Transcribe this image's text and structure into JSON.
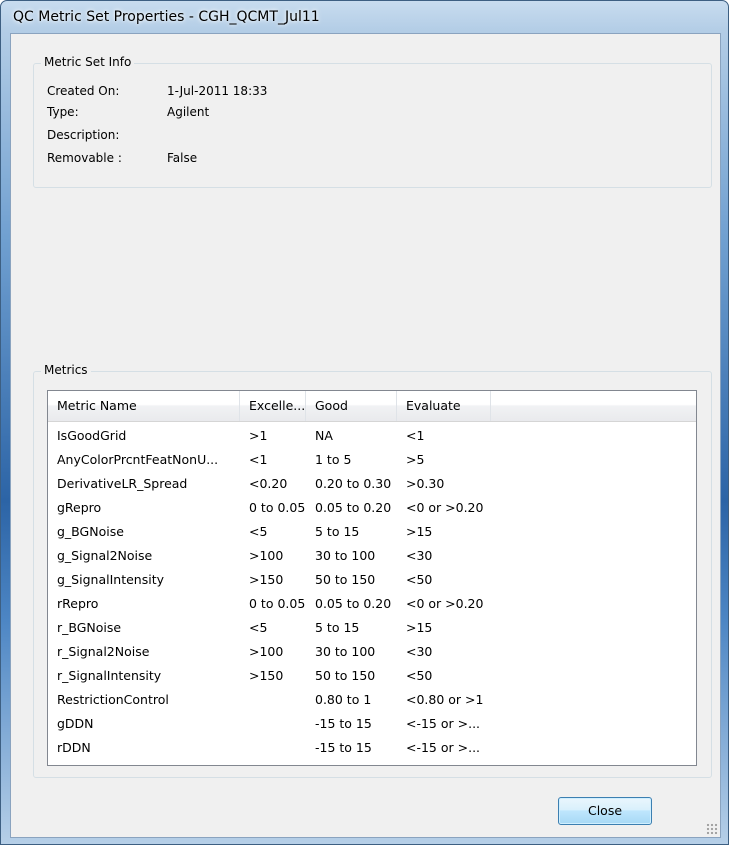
{
  "window": {
    "title": "QC Metric Set Properties - CGH_QCMT_Jul11"
  },
  "metric_set_info": {
    "group_label": "Metric Set Info",
    "fields": [
      {
        "label": "Created On:",
        "value": "1-Jul-2011 18:33"
      },
      {
        "label": "Type:",
        "value": "Agilent"
      },
      {
        "label": "Description:",
        "value": ""
      },
      {
        "label": "Removable :",
        "value": "False"
      }
    ]
  },
  "metrics": {
    "group_label": "Metrics",
    "columns": [
      "Metric Name",
      "Excelle...",
      "Good",
      "Evaluate",
      ""
    ],
    "rows": [
      [
        "IsGoodGrid",
        ">1",
        "NA",
        "<1"
      ],
      [
        "AnyColorPrcntFeatNonU...",
        "<1",
        "1 to 5",
        ">5"
      ],
      [
        "DerivativeLR_Spread",
        "<0.20",
        "0.20 to 0.30",
        ">0.30"
      ],
      [
        "gRepro",
        "0 to 0.05",
        "0.05 to 0.20",
        "<0 or >0.20"
      ],
      [
        "g_BGNoise",
        "<5",
        "5 to 15",
        ">15"
      ],
      [
        "g_Signal2Noise",
        ">100",
        "30 to 100",
        "<30"
      ],
      [
        "g_SignalIntensity",
        ">150",
        "50 to 150",
        "<50"
      ],
      [
        "rRepro",
        "0 to 0.05",
        "0.05 to 0.20",
        "<0 or >0.20"
      ],
      [
        "r_BGNoise",
        "<5",
        "5 to 15",
        ">15"
      ],
      [
        "r_Signal2Noise",
        ">100",
        "30 to 100",
        "<30"
      ],
      [
        "r_SignalIntensity",
        ">150",
        "50 to 150",
        "<50"
      ],
      [
        "RestrictionControl",
        "",
        "0.80 to 1",
        "<0.80 or >1"
      ],
      [
        "gDDN",
        "",
        "-15 to 15",
        "<-15 or >..."
      ],
      [
        "rDDN",
        "",
        "-15 to 15",
        "<-15 or >..."
      ]
    ]
  },
  "footer": {
    "close_label": "Close"
  }
}
